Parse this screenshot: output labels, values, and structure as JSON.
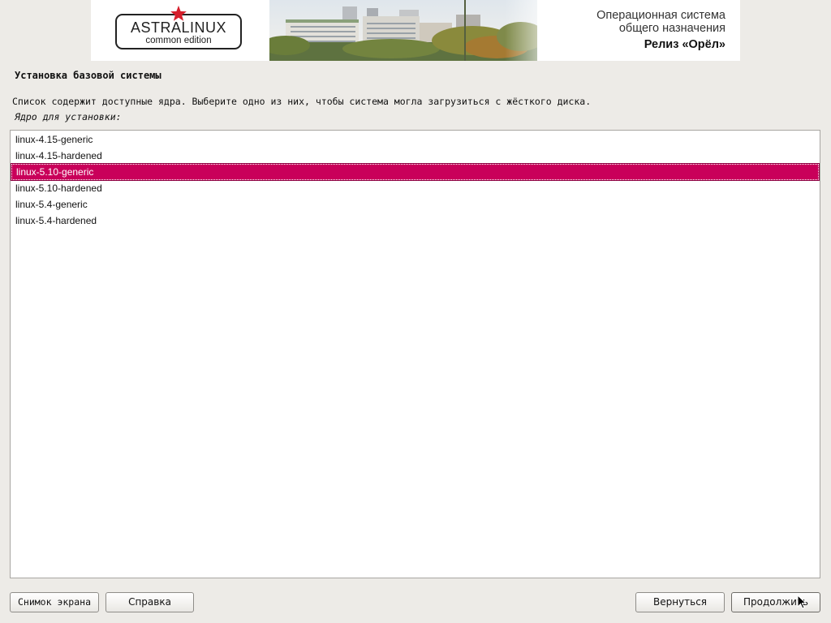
{
  "banner": {
    "logo_main": "ASTRALINUX",
    "logo_sub": "common edition",
    "os_line1": "Операционная система",
    "os_line2": "общего назначения",
    "release": "Релиз «Орёл»"
  },
  "page": {
    "title": "Установка базовой системы",
    "description": "Список содержит доступные ядра. Выберите одно из них, чтобы система могла загрузиться с жёсткого диска.",
    "list_label": "Ядро для установки:"
  },
  "kernels": [
    {
      "label": "linux-4.15-generic"
    },
    {
      "label": "linux-4.15-hardened"
    },
    {
      "label": "linux-5.10-generic",
      "selected": true
    },
    {
      "label": "linux-5.10-hardened"
    },
    {
      "label": "linux-5.4-generic"
    },
    {
      "label": "linux-5.4-hardened"
    }
  ],
  "buttons": {
    "screenshot": "Снимок экрана",
    "help": "Справка",
    "back": "Вернуться",
    "continue": "Продолжить"
  },
  "colors": {
    "selection": "#c9005a",
    "background": "#edebe7",
    "logo_star": "#d61f2c"
  }
}
